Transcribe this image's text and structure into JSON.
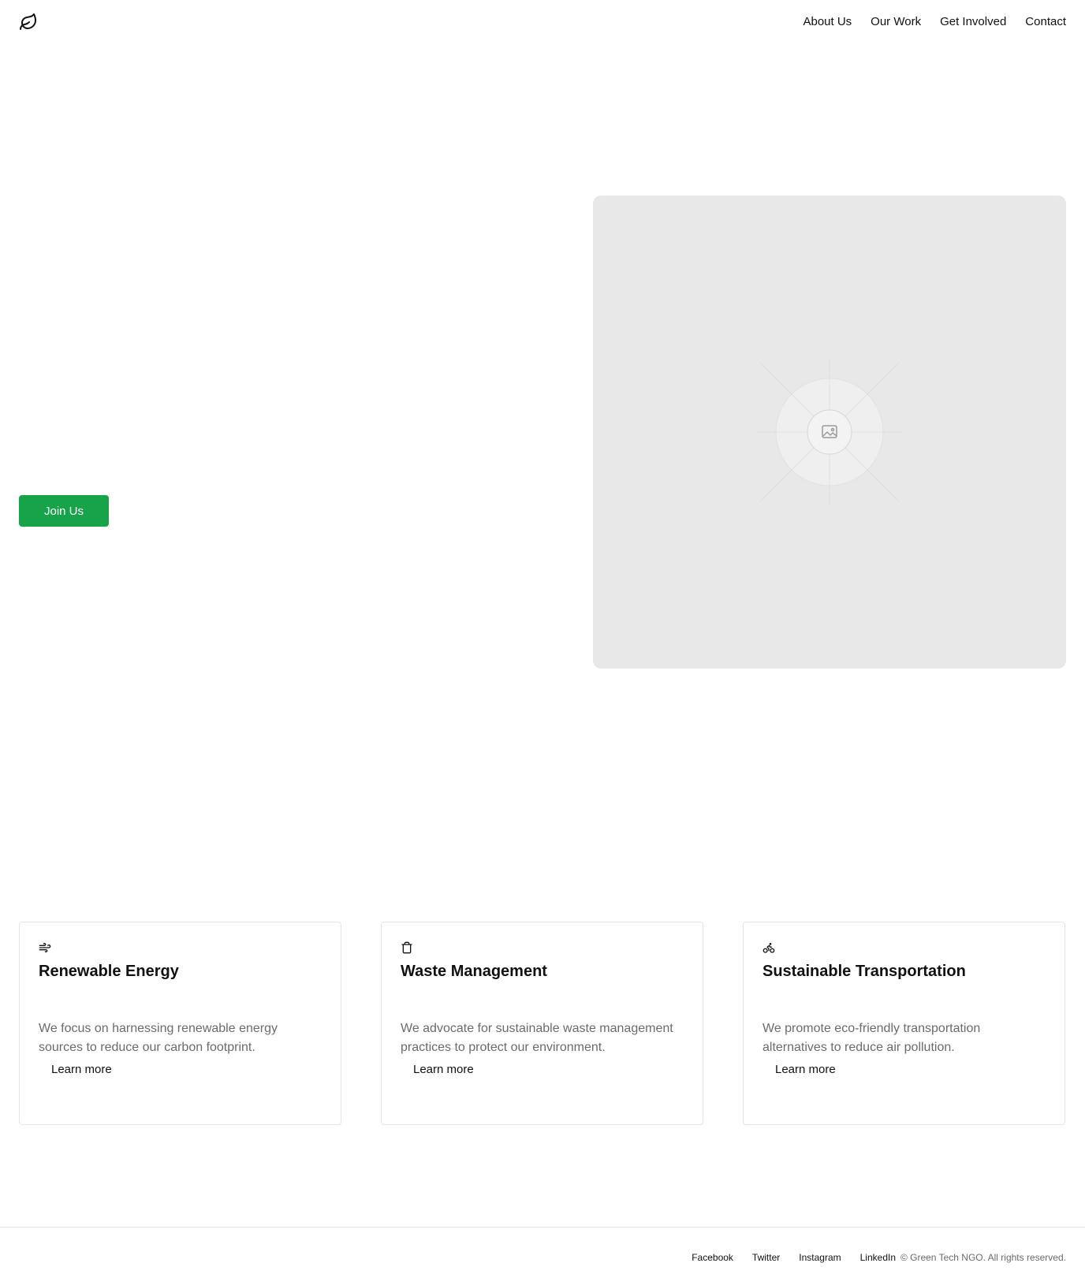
{
  "header": {
    "logo_icon": "leaf-icon",
    "nav": [
      {
        "label": "About Us"
      },
      {
        "label": "Our Work"
      },
      {
        "label": "Get Involved"
      },
      {
        "label": "Contact"
      }
    ]
  },
  "hero": {
    "cta_label": "Join Us",
    "cta_color": "#16a34a",
    "image_placeholder_icon": "image-icon"
  },
  "cards": [
    {
      "icon": "wind-icon",
      "title": "Renewable Energy",
      "description": "We focus on harnessing renewable energy sources to reduce our carbon footprint.",
      "link": "Learn more"
    },
    {
      "icon": "trash-icon",
      "title": "Waste Management",
      "description": "We advocate for sustainable waste management practices to protect our environment.",
      "link": "Learn more"
    },
    {
      "icon": "bike-icon",
      "title": "Sustainable Transportation",
      "description": "We promote eco-friendly transportation alternatives to reduce air pollution.",
      "link": "Learn more"
    }
  ],
  "footer": {
    "links": [
      {
        "label": "Facebook"
      },
      {
        "label": "Twitter"
      },
      {
        "label": "Instagram"
      },
      {
        "label": "LinkedIn"
      }
    ],
    "copyright": "© Green Tech NGO. All rights reserved."
  }
}
